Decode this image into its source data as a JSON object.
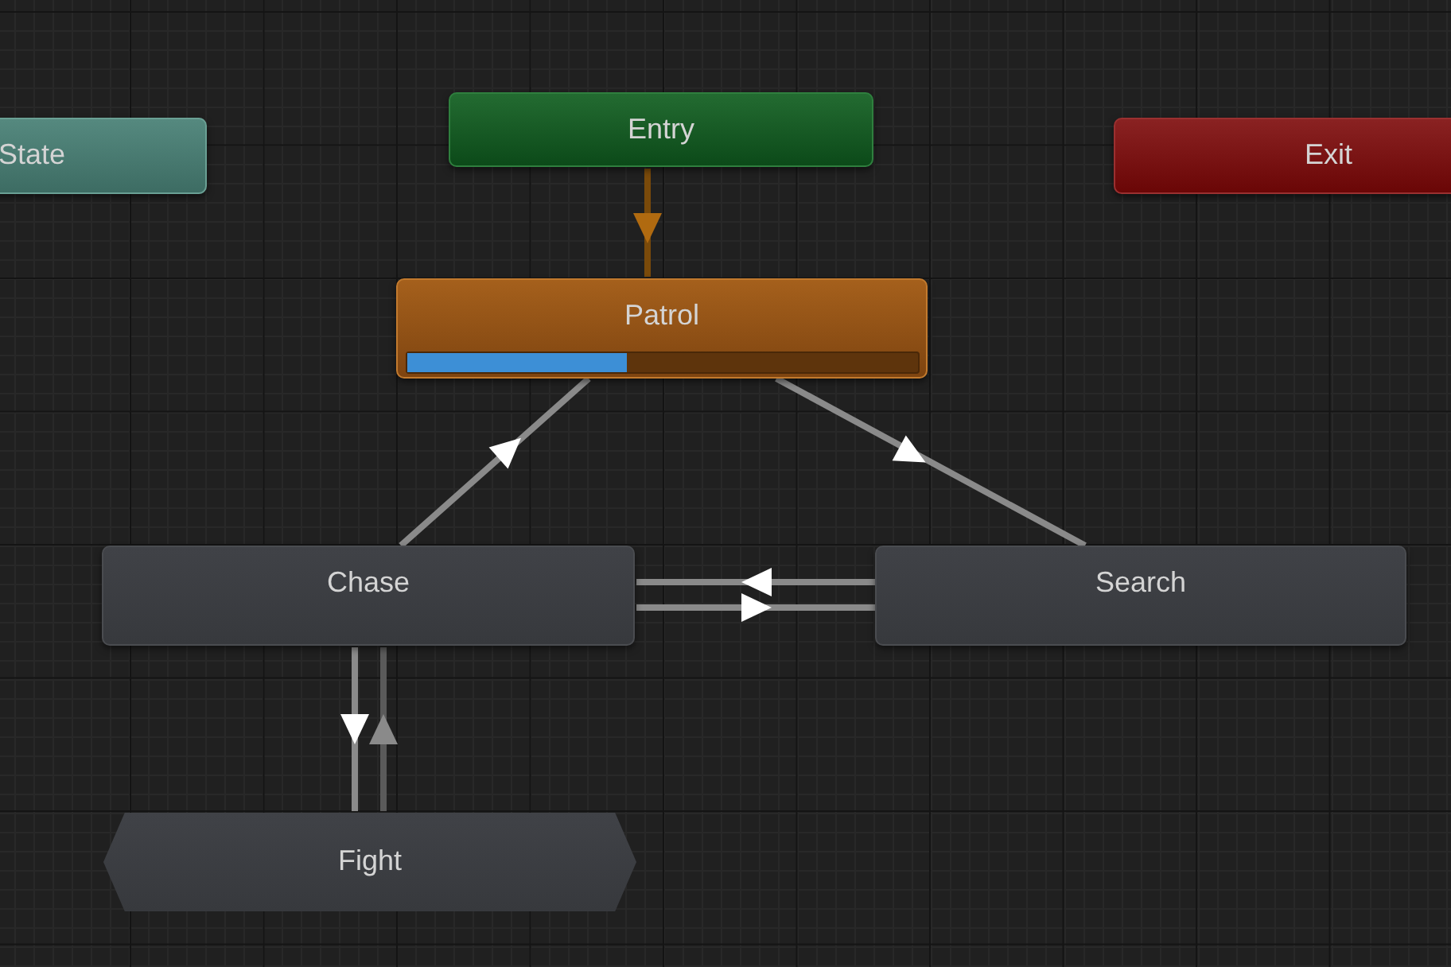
{
  "nodes": [
    {
      "kind": "any",
      "label": "State"
    },
    {
      "kind": "entry",
      "label": "Entry"
    },
    {
      "kind": "exit",
      "label": "Exit"
    },
    {
      "kind": "default",
      "label": "Patrol",
      "level": 0.43
    },
    {
      "kind": "state",
      "label": "Chase"
    },
    {
      "kind": "state",
      "label": "Search"
    },
    {
      "kind": "substate",
      "label": "Fight"
    }
  ]
}
